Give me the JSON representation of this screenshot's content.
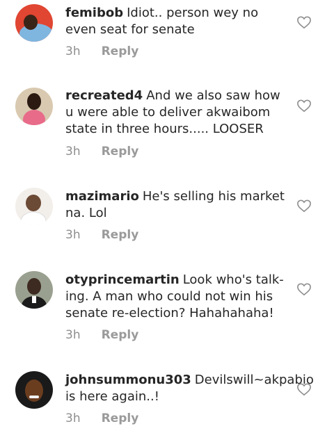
{
  "comments": [
    {
      "username": "femibob",
      "text": "Idiot.. person wey no even seat for senate",
      "time": "3h",
      "reply_label": "Reply",
      "avatar_icon": "user-avatar"
    },
    {
      "username": "recreated4",
      "text": "And we also saw how u were able to deliver akwaibom state in three hours..... LOOSER",
      "time": "3h",
      "reply_label": "Reply",
      "avatar_icon": "user-avatar"
    },
    {
      "username": "mazimario",
      "text": "He's selling his market na. Lol",
      "time": "3h",
      "reply_label": "Reply",
      "avatar_icon": "user-avatar"
    },
    {
      "username": "otyprincemartin",
      "text": "Look who's talk-ing. A man who could not win his senate re-election? Hahahahaha!",
      "time": "3h",
      "reply_label": "Reply",
      "avatar_icon": "user-avatar"
    },
    {
      "username": "johnsummonu303",
      "text": "Devilswill~akpabio is here again..!",
      "time": "3h",
      "reply_label": "Reply",
      "avatar_icon": "user-avatar"
    }
  ],
  "colors": {
    "text": "#262626",
    "meta": "#8e8e8e"
  }
}
